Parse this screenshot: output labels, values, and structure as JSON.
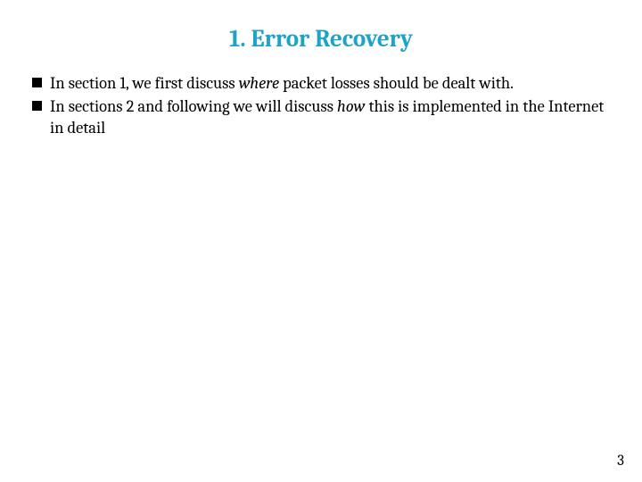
{
  "title": "1. Error Recovery",
  "bullets": [
    {
      "pre": "In section 1, we first discuss ",
      "em": "where",
      "post": "  packet losses should be dealt with."
    },
    {
      "pre": "In sections 2 and following we will discuss ",
      "em": "how",
      "post": " this is implemented in the Internet in detail"
    }
  ],
  "pageNumber": "3"
}
